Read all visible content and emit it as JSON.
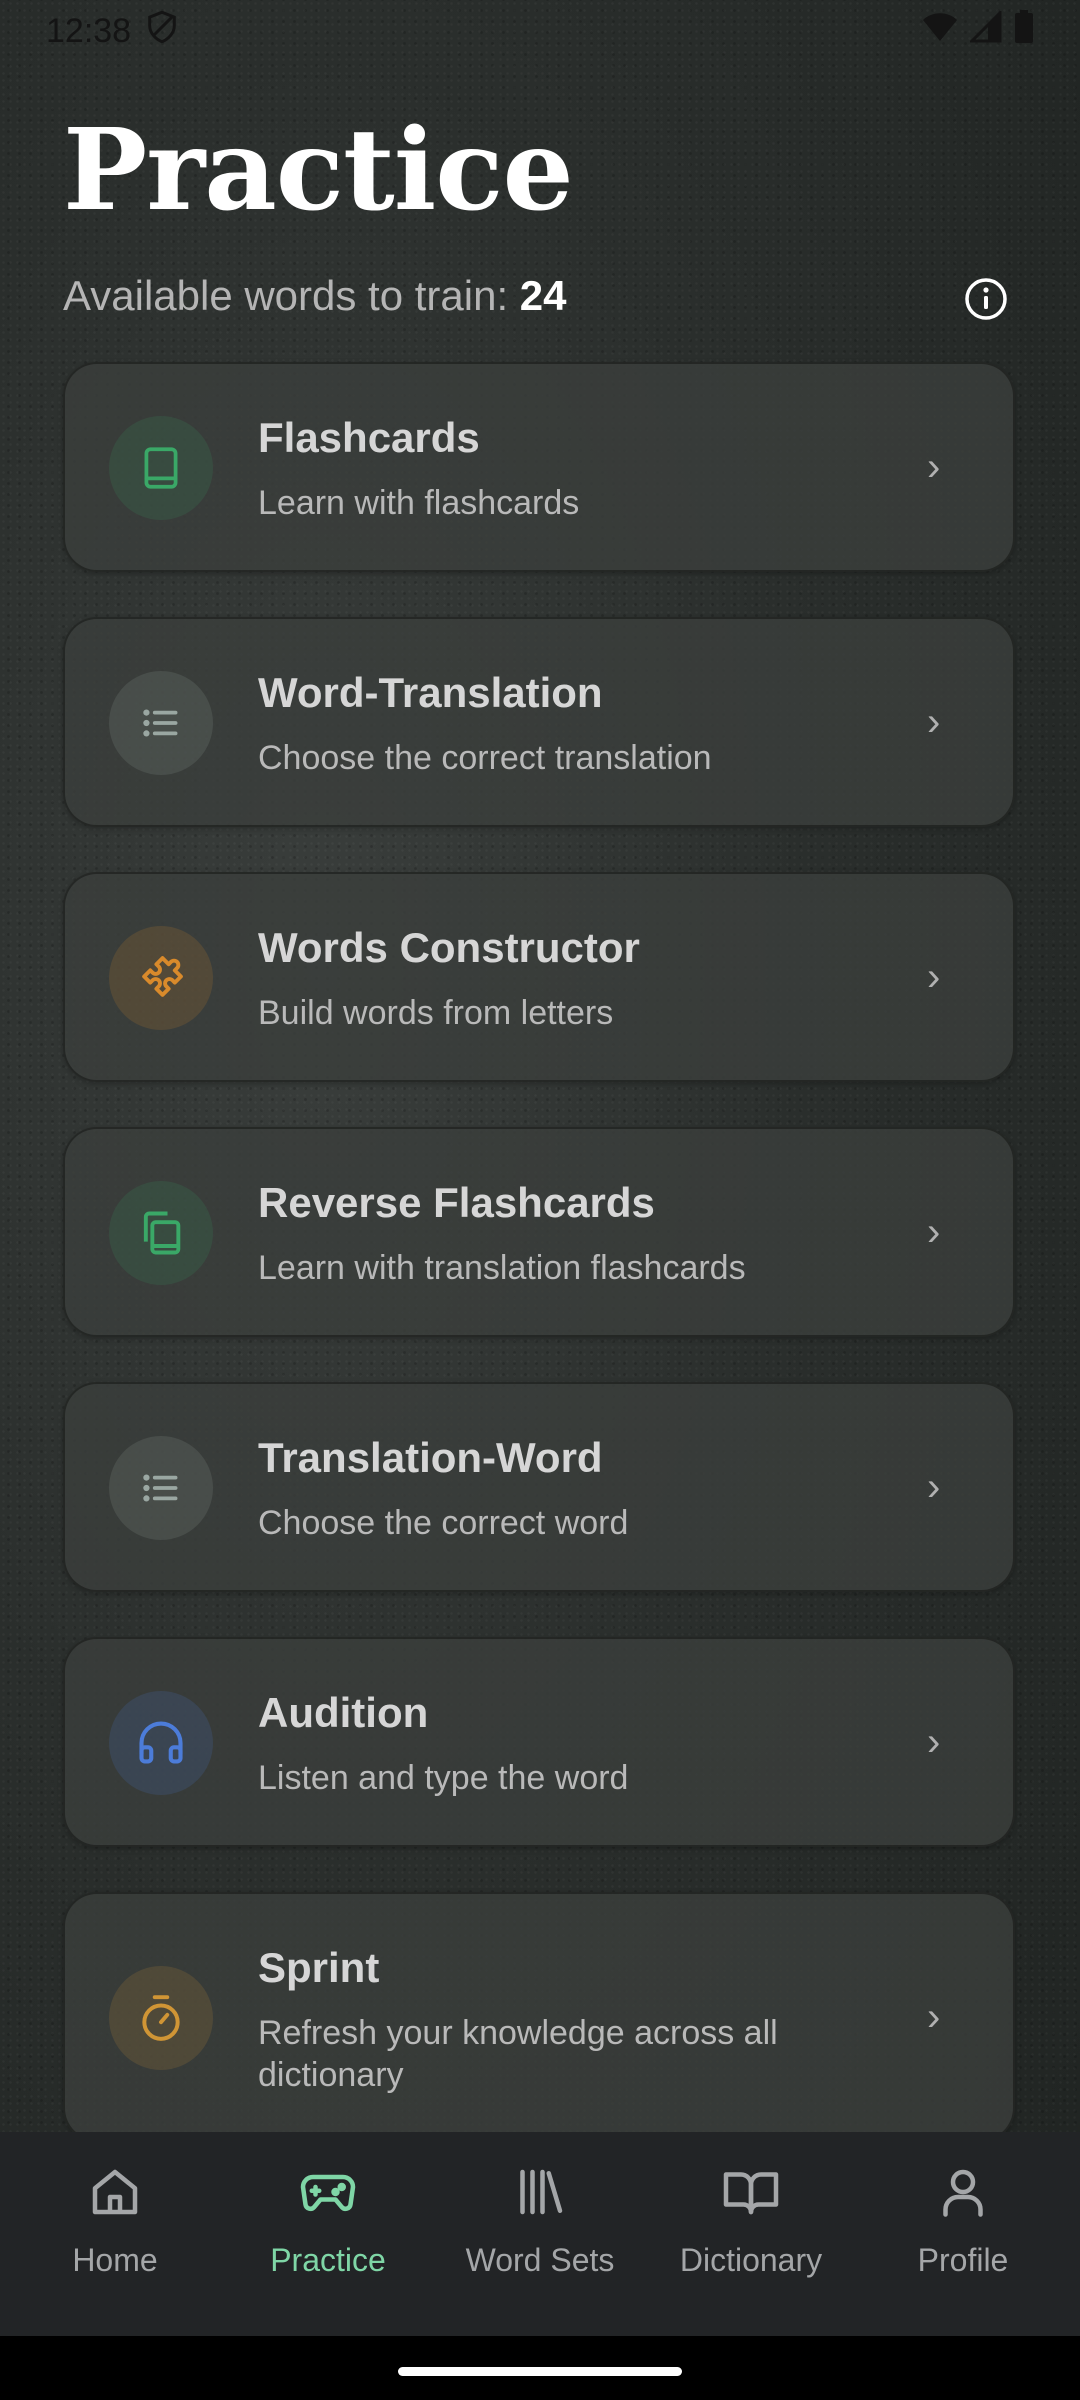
{
  "status_bar": {
    "time": "12:38"
  },
  "header": {
    "title": "Practice",
    "available_label": "Available words to train:",
    "available_count": "24"
  },
  "colors": {
    "accent_green": "#7fd6a6",
    "green_icon": "#3aa867",
    "grey_icon": "#9aa7a2",
    "orange_icon": "#d98a2b",
    "blue_icon": "#4c7cd9",
    "amber_icon": "#d09535"
  },
  "modes": [
    {
      "title": "Flashcards",
      "subtitle": "Learn with flashcards",
      "icon": "book-icon"
    },
    {
      "title": "Word-Translation",
      "subtitle": "Choose the correct translation",
      "icon": "list-icon"
    },
    {
      "title": "Words Constructor",
      "subtitle": "Build words from letters",
      "icon": "puzzle-icon"
    },
    {
      "title": "Reverse Flashcards",
      "subtitle": "Learn with translation flashcards",
      "icon": "copy-cards-icon"
    },
    {
      "title": "Translation-Word",
      "subtitle": "Choose the correct word",
      "icon": "list-icon"
    },
    {
      "title": "Audition",
      "subtitle": "Listen and type the word",
      "icon": "headphones-icon"
    },
    {
      "title": "Sprint",
      "subtitle": "Refresh your knowledge across all dictionary",
      "icon": "timer-icon"
    }
  ],
  "chevron": "›",
  "nav": {
    "items": [
      {
        "label": "Home",
        "icon": "home-icon"
      },
      {
        "label": "Practice",
        "icon": "gamepad-icon",
        "active": true
      },
      {
        "label": "Word Sets",
        "icon": "library-icon"
      },
      {
        "label": "Dictionary",
        "icon": "open-book-icon"
      },
      {
        "label": "Profile",
        "icon": "person-icon"
      }
    ]
  }
}
